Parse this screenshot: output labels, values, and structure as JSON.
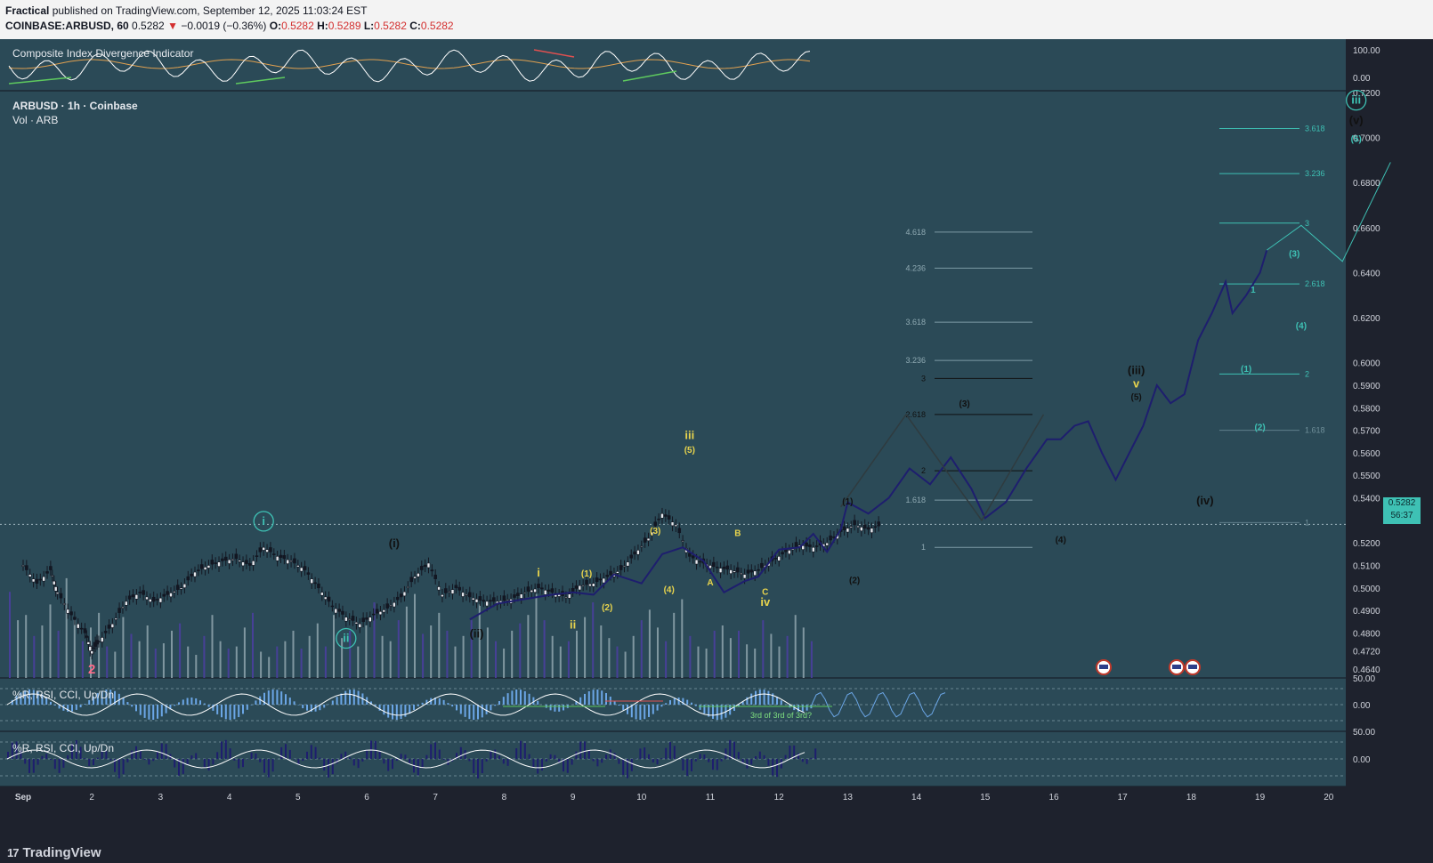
{
  "header": {
    "publisher": "Fractical",
    "published_text": "published on TradingView.com, September 12, 2025 11:03:24 EST",
    "symbol": "COINBASE:ARBUSD, 60",
    "price": "0.5282",
    "change_arrow": "▼",
    "change": "−0.0019 (−0.36%)",
    "o_label": "O:",
    "o_val": "0.5282",
    "h_label": "H:",
    "h_val": "0.5289",
    "l_label": "L:",
    "l_val": "0.5282",
    "c_label": "C:",
    "c_val": "0.5282"
  },
  "cidi_pane": {
    "title": "Composite Index Divergence Indicator",
    "ticks": [
      "100.00",
      "0.00"
    ]
  },
  "main_pane": {
    "title": "ARBUSD · 1h · Coinbase",
    "subtitle": "Vol · ARB",
    "last_price_tag": "0.5282",
    "countdown": "56:37"
  },
  "osc1": {
    "title": "%R, RSI, CCI, Up/Dn",
    "ticks": [
      "50.00",
      "0.00"
    ],
    "note": "3rd of 3rd of 3rd?"
  },
  "osc2": {
    "title": "%R, RSI, CCI, Up/Dn",
    "ticks": [
      "50.00",
      "0.00"
    ]
  },
  "footer": {
    "brand": "TradingView",
    "logo_icon": "tradingview-logo-icon"
  },
  "colors": {
    "bg": "#2b4a57",
    "candle": "#131722",
    "projection": "#1e1e6e",
    "fib_cyan": "#3ec1b4",
    "wave_yellow": "#e8d44d",
    "down": "#d32f2f"
  },
  "chart_data": {
    "type": "candlestick",
    "ylim": [
      0.46,
      0.72
    ],
    "y_ticks": [
      "0.7200",
      "0.7000",
      "0.6800",
      "0.6600",
      "0.6400",
      "0.6200",
      "0.6000",
      "0.5900",
      "0.5800",
      "0.5700",
      "0.5600",
      "0.5500",
      "0.5400",
      "0.5282",
      "0.5200",
      "0.5100",
      "0.5000",
      "0.4900",
      "0.4800",
      "0.4720",
      "0.4640"
    ],
    "x_ticks": [
      "Sep",
      "2",
      "3",
      "4",
      "5",
      "6",
      "7",
      "8",
      "9",
      "10",
      "11",
      "12",
      "13",
      "14",
      "15",
      "16",
      "17",
      "18",
      "19",
      "20"
    ],
    "close_path": [
      [
        0.0,
        0.51
      ],
      [
        0.2,
        0.502
      ],
      [
        0.4,
        0.508
      ],
      [
        0.5,
        0.498
      ],
      [
        0.7,
        0.488
      ],
      [
        0.9,
        0.48
      ],
      [
        1.0,
        0.472
      ],
      [
        1.1,
        0.476
      ],
      [
        1.3,
        0.484
      ],
      [
        1.5,
        0.494
      ],
      [
        1.7,
        0.498
      ],
      [
        1.9,
        0.494
      ],
      [
        2.1,
        0.497
      ],
      [
        2.3,
        0.5
      ],
      [
        2.5,
        0.507
      ],
      [
        2.7,
        0.51
      ],
      [
        2.9,
        0.512
      ],
      [
        3.1,
        0.513
      ],
      [
        3.3,
        0.51
      ],
      [
        3.5,
        0.518
      ],
      [
        3.7,
        0.514
      ],
      [
        3.9,
        0.512
      ],
      [
        4.1,
        0.508
      ],
      [
        4.3,
        0.5
      ],
      [
        4.5,
        0.492
      ],
      [
        4.7,
        0.487
      ],
      [
        4.9,
        0.484
      ],
      [
        5.1,
        0.488
      ],
      [
        5.3,
        0.491
      ],
      [
        5.5,
        0.496
      ],
      [
        5.7,
        0.505
      ],
      [
        5.9,
        0.511
      ],
      [
        6.1,
        0.497
      ],
      [
        6.3,
        0.5
      ],
      [
        6.5,
        0.496
      ],
      [
        6.7,
        0.494
      ],
      [
        6.9,
        0.494
      ],
      [
        7.1,
        0.495
      ],
      [
        7.3,
        0.498
      ],
      [
        7.5,
        0.5
      ],
      [
        7.7,
        0.498
      ],
      [
        7.9,
        0.496
      ],
      [
        8.1,
        0.501
      ],
      [
        8.3,
        0.502
      ],
      [
        8.5,
        0.505
      ],
      [
        8.7,
        0.508
      ],
      [
        8.9,
        0.515
      ],
      [
        9.1,
        0.522
      ],
      [
        9.3,
        0.533
      ],
      [
        9.5,
        0.528
      ],
      [
        9.7,
        0.514
      ],
      [
        9.9,
        0.511
      ],
      [
        10.1,
        0.509
      ],
      [
        10.3,
        0.508
      ],
      [
        10.5,
        0.506
      ],
      [
        10.7,
        0.508
      ],
      [
        10.9,
        0.512
      ],
      [
        11.1,
        0.516
      ],
      [
        11.3,
        0.519
      ],
      [
        11.5,
        0.518
      ],
      [
        11.7,
        0.52
      ],
      [
        11.9,
        0.525
      ],
      [
        12.1,
        0.528
      ],
      [
        12.3,
        0.526
      ],
      [
        12.5,
        0.528
      ]
    ],
    "volume": [
      0.82,
      0.55,
      0.6,
      0.4,
      0.5,
      0.7,
      0.45,
      0.95,
      0.55,
      0.35,
      0.48,
      0.62,
      0.3,
      0.25,
      0.58,
      0.42,
      0.35,
      0.5,
      0.28,
      0.33,
      0.45,
      0.52,
      0.3,
      0.22,
      0.4,
      0.6,
      0.35,
      0.28,
      0.3,
      0.48,
      0.62,
      0.25,
      0.2,
      0.3,
      0.35,
      0.45,
      0.28,
      0.4,
      0.52,
      0.3,
      0.6,
      0.38,
      0.45,
      0.3,
      0.5,
      0.72,
      0.4,
      0.35,
      0.55,
      0.68,
      0.8,
      0.42,
      0.5,
      0.62,
      0.45,
      0.3,
      0.4,
      0.55,
      0.7,
      0.48,
      0.35,
      0.28,
      0.45,
      0.52,
      0.6,
      0.8,
      0.55,
      0.4,
      0.3,
      0.35,
      0.45,
      0.58,
      0.72,
      0.5,
      0.38,
      0.3,
      0.25,
      0.4,
      0.55,
      0.65,
      0.48,
      0.35,
      0.62,
      0.75,
      0.4,
      0.3,
      0.28,
      0.45,
      0.5,
      0.38,
      0.45,
      0.32,
      0.28,
      0.55,
      0.42,
      0.3,
      0.4,
      0.6,
      0.48,
      0.35
    ],
    "projection_path": [
      [
        6.5,
        0.486
      ],
      [
        6.9,
        0.493
      ],
      [
        7.3,
        0.495
      ],
      [
        7.7,
        0.497
      ],
      [
        8.0,
        0.498
      ],
      [
        8.3,
        0.497
      ],
      [
        8.6,
        0.506
      ],
      [
        9.0,
        0.502
      ],
      [
        9.3,
        0.515
      ],
      [
        9.6,
        0.518
      ],
      [
        9.9,
        0.512
      ],
      [
        10.2,
        0.498
      ],
      [
        10.5,
        0.503
      ],
      [
        10.7,
        0.505
      ],
      [
        11.0,
        0.517
      ],
      [
        11.3,
        0.518
      ],
      [
        11.5,
        0.524
      ],
      [
        11.7,
        0.516
      ],
      [
        11.9,
        0.526
      ],
      [
        12.0,
        0.538
      ],
      [
        12.3,
        0.533
      ],
      [
        12.6,
        0.54
      ],
      [
        12.9,
        0.553
      ],
      [
        13.2,
        0.546
      ],
      [
        13.5,
        0.558
      ],
      [
        13.8,
        0.544
      ],
      [
        14.0,
        0.531
      ],
      [
        14.3,
        0.538
      ],
      [
        14.6,
        0.553
      ],
      [
        14.9,
        0.566
      ],
      [
        15.1,
        0.566
      ],
      [
        15.3,
        0.572
      ],
      [
        15.5,
        0.574
      ],
      [
        15.7,
        0.56
      ],
      [
        15.9,
        0.548
      ],
      [
        16.1,
        0.56
      ],
      [
        16.3,
        0.572
      ],
      [
        16.5,
        0.59
      ],
      [
        16.7,
        0.582
      ],
      [
        16.9,
        0.586
      ],
      [
        17.1,
        0.61
      ],
      [
        17.3,
        0.622
      ],
      [
        17.5,
        0.636
      ],
      [
        17.6,
        0.622
      ],
      [
        17.8,
        0.63
      ],
      [
        18.0,
        0.64
      ],
      [
        18.1,
        0.65
      ]
    ],
    "fib_levels_left": [
      {
        "label": "4.618",
        "value": 0.658
      },
      {
        "label": "4.236",
        "value": 0.642
      },
      {
        "label": "3.618",
        "value": 0.618
      },
      {
        "label": "3.236",
        "value": 0.601
      },
      {
        "label": "3",
        "value": 0.593
      },
      {
        "label": "2.618",
        "value": 0.577
      },
      {
        "label": "2",
        "value": 0.552
      },
      {
        "label": "1.618",
        "value": 0.539
      },
      {
        "label": "1",
        "value": 0.518
      }
    ],
    "fib_levels_right": [
      {
        "label": "3.618",
        "value": 0.704
      },
      {
        "label": "3.236",
        "value": 0.684
      },
      {
        "label": "3",
        "value": 0.662
      },
      {
        "label": "2.618",
        "value": 0.635
      },
      {
        "label": "2",
        "value": 0.595
      },
      {
        "label": "1.618",
        "value": 0.57
      },
      {
        "label": "1",
        "value": 0.529
      }
    ],
    "wave_labels": [
      {
        "text": "i",
        "x": 3.5,
        "y": 0.528,
        "style": "circle"
      },
      {
        "text": "(i)",
        "x": 5.4,
        "y": 0.518,
        "style": "paren"
      },
      {
        "text": "ii",
        "x": 4.7,
        "y": 0.476,
        "style": "circle"
      },
      {
        "text": "(ii)",
        "x": 6.6,
        "y": 0.478,
        "style": "paren"
      },
      {
        "text": "i",
        "x": 7.5,
        "y": 0.505,
        "style": "yellow"
      },
      {
        "text": "ii",
        "x": 8.0,
        "y": 0.482,
        "style": "yellow"
      },
      {
        "text": "(1)",
        "x": 8.2,
        "y": 0.505,
        "style": "yellow-small"
      },
      {
        "text": "(2)",
        "x": 8.5,
        "y": 0.49,
        "style": "yellow-small"
      },
      {
        "text": "(3)",
        "x": 9.2,
        "y": 0.524,
        "style": "yellow-small"
      },
      {
        "text": "(4)",
        "x": 9.4,
        "y": 0.498,
        "style": "yellow-small"
      },
      {
        "text": "iii",
        "x": 9.7,
        "y": 0.566,
        "style": "yellow"
      },
      {
        "text": "(5)",
        "x": 9.7,
        "y": 0.56,
        "style": "yellow-small"
      },
      {
        "text": "A",
        "x": 10.0,
        "y": 0.501,
        "style": "yellow-small"
      },
      {
        "text": "B",
        "x": 10.4,
        "y": 0.523,
        "style": "yellow-small"
      },
      {
        "text": "C",
        "x": 10.8,
        "y": 0.497,
        "style": "yellow-small"
      },
      {
        "text": "iv",
        "x": 10.8,
        "y": 0.492,
        "style": "yellow"
      },
      {
        "text": "(1)",
        "x": 12.0,
        "y": 0.537,
        "style": "dark-small"
      },
      {
        "text": "(2)",
        "x": 12.1,
        "y": 0.502,
        "style": "dark-small"
      },
      {
        "text": "(3)",
        "x": 13.7,
        "y": 0.5805,
        "style": "dark-small"
      },
      {
        "text": "(4)",
        "x": 15.1,
        "y": 0.52,
        "style": "dark-small"
      },
      {
        "text": "(iii)",
        "x": 16.2,
        "y": 0.595,
        "style": "paren"
      },
      {
        "text": "v",
        "x": 16.2,
        "y": 0.589,
        "style": "yellow"
      },
      {
        "text": "(5)",
        "x": 16.2,
        "y": 0.5835,
        "style": "dark-small"
      },
      {
        "text": "(iv)",
        "x": 17.2,
        "y": 0.537,
        "style": "paren"
      },
      {
        "text": "(1)",
        "x": 17.8,
        "y": 0.596,
        "style": "cyan-small"
      },
      {
        "text": "(2)",
        "x": 18.0,
        "y": 0.57,
        "style": "cyan-small"
      },
      {
        "text": "1",
        "x": 17.9,
        "y": 0.631,
        "style": "cyan-small"
      },
      {
        "text": "(3)",
        "x": 18.5,
        "y": 0.647,
        "style": "cyan-small"
      },
      {
        "text": "(4)",
        "x": 18.6,
        "y": 0.615,
        "style": "cyan-small"
      },
      {
        "text": "(5)",
        "x": 19.4,
        "y": 0.698,
        "style": "cyan-small"
      },
      {
        "text": "(v)",
        "x": 19.4,
        "y": 0.706,
        "style": "paren"
      },
      {
        "text": "iii",
        "x": 19.4,
        "y": 0.715,
        "style": "circle"
      },
      {
        "text": "2",
        "x": 1.0,
        "y": 0.462,
        "style": "red"
      }
    ]
  }
}
